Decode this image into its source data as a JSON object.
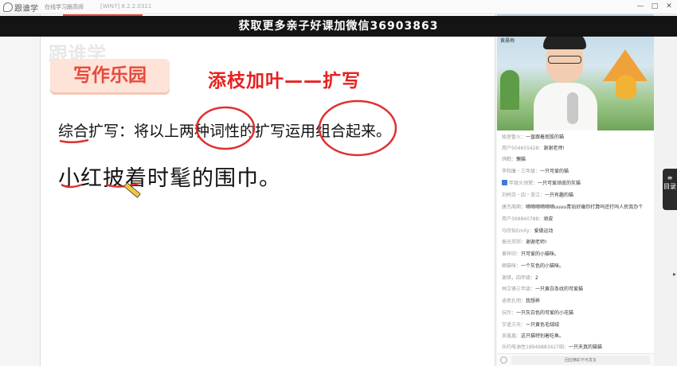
{
  "app": {
    "brand": "跟谁学",
    "subtitle": "在线学习跟高师",
    "version": "[WIN7] 8.2.2.0311",
    "window_buttons": [
      "—",
      "□",
      "✕"
    ]
  },
  "banner": {
    "text": "获取更多亲子好课加微信36903863"
  },
  "slide": {
    "watermark": "跟谁学",
    "section_label": "写作乐园",
    "heading": "添枝加叶——扩写",
    "instruction": "综合扩写：将以上两种词性的扩写运用组合起来。",
    "sentence": "小红披着时髦的围巾。"
  },
  "video": {
    "name_tag": "黄晨梅"
  },
  "chat": {
    "messages": [
      {
        "user": "故居暂火：",
        "text": "一直跟着屁股的猫"
      },
      {
        "user": "用户504655428：",
        "text": "谢谢老师!"
      },
      {
        "user": "鸽鹤：",
        "text": "懒猫"
      },
      {
        "user": "李和康・三年级：",
        "text": "一只可爱的猫"
      },
      {
        "user": "年级头领黛：",
        "text": "一只可爱顽皮的灰猫",
        "badge": true
      },
      {
        "user": "刘柯尧・四・浙江：",
        "text": "一只有趣的猫"
      },
      {
        "user": "唐杰蔺蔺：",
        "text": "嘀嘀嘀嘀嘀嘀uuuu青铅好痛你打算吗还打吗人民我办个"
      },
      {
        "user": "用户399840788：",
        "text": "顽皮"
      },
      {
        "user": "马欣怡Emily：",
        "text": "爱做运动"
      },
      {
        "user": "振光郊郊：",
        "text": "谢谢老师!"
      },
      {
        "user": "黄梓印：",
        "text": "只可爱的小猫咪。"
      },
      {
        "user": "卿猫咪：",
        "text": "一个灰色的小猫咪。"
      },
      {
        "user": "谢琪，四年级：",
        "text": "2"
      },
      {
        "user": "林立锋三年级：",
        "text": "一只黄白条纹的可爱猫"
      },
      {
        "user": "迪思孔明：",
        "text": "我想养"
      },
      {
        "user": "玩玲：",
        "text": "一只灰白色的可爱的小花猫"
      },
      {
        "user": "宇遥方天：",
        "text": "一只黄色毛绒绒"
      },
      {
        "user": "吴鑫鑫：",
        "text": "这只猫特别着吃鱼。"
      },
      {
        "user": "乐约电油性18949883427田：",
        "text": "一只天真的猫猫"
      }
    ],
    "input_placeholder": "回应精彩不可发言"
  },
  "side_tab": {
    "label": "目录"
  },
  "colors": {
    "accent_red": "#e84a3c",
    "heading_red": "#e82020",
    "banner_bg": "#141414"
  }
}
